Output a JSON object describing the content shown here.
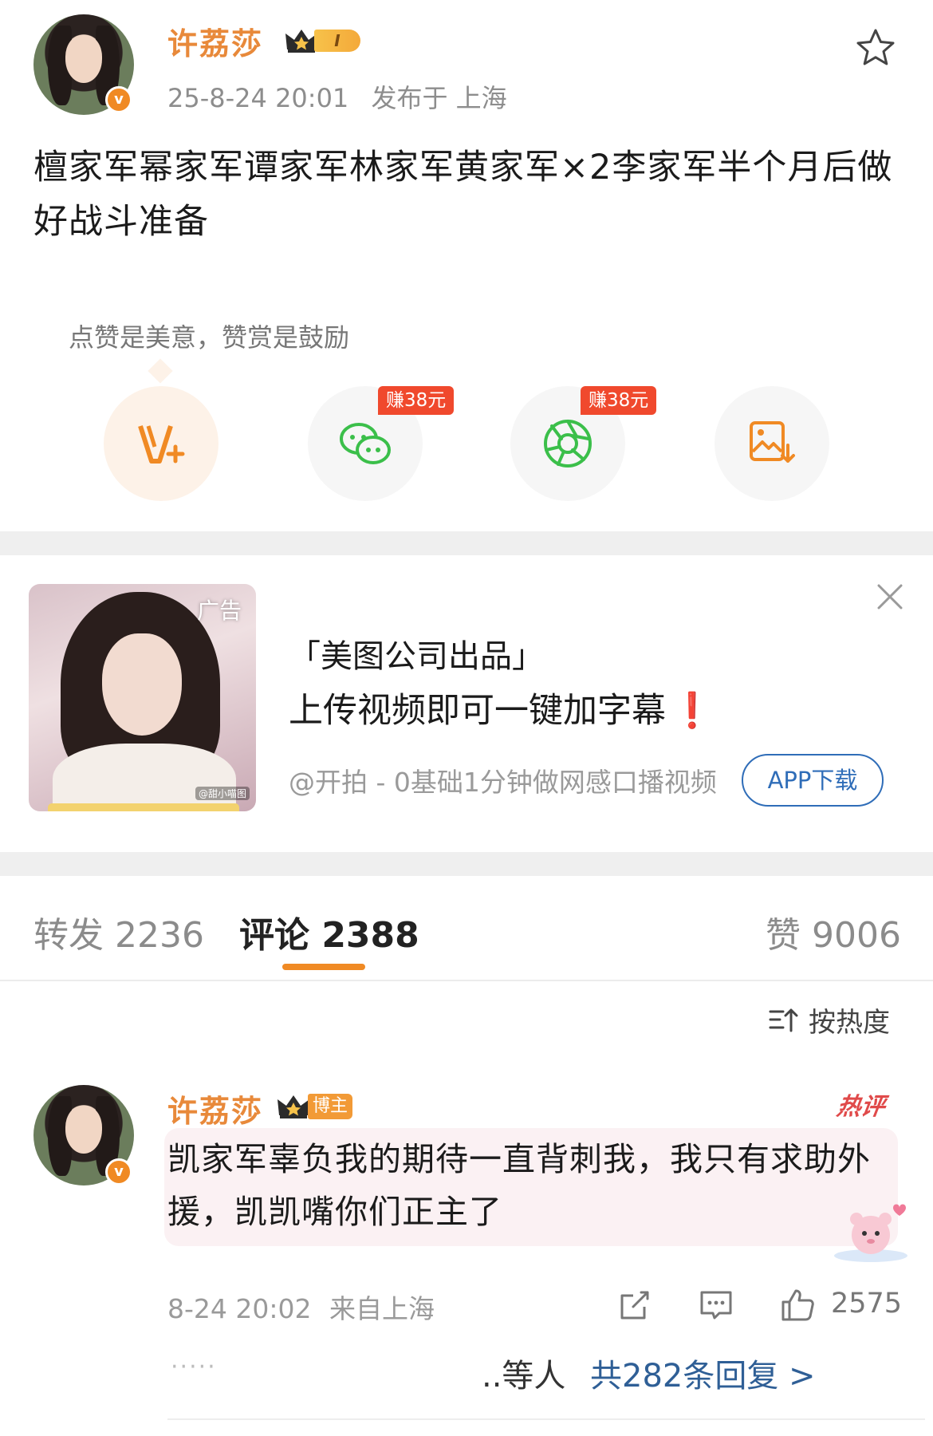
{
  "post": {
    "author": "许荔莎",
    "level": "I",
    "verified_mark": "v",
    "date": "25-8-24 20:01",
    "location": "发布于 上海",
    "content": "檀家军幂家军谭家军林家军黄家军×2李家军半个月后做好战斗准备"
  },
  "reward": {
    "hint": "点赞是美意，赞赏是鼓励",
    "buttons": [
      {
        "icon": "v-plus-icon"
      },
      {
        "icon": "wechat-icon",
        "tag": "赚38元"
      },
      {
        "icon": "moments-shutter-icon",
        "tag": "赚38元"
      },
      {
        "icon": "save-image-icon"
      }
    ]
  },
  "ad": {
    "tag": "广告",
    "watermark": "@甜小喵图",
    "line1": "「美图公司出品」",
    "line2": "上传视频即可一键加字幕",
    "line2_mark": "❗",
    "source": "@开拍 - 0基础1分钟做网感口播视频",
    "button": "APP下载"
  },
  "tabs": {
    "repost": "转发 2236",
    "comments": "评论 2388",
    "likes": "赞 9006"
  },
  "sort": {
    "label": "按热度"
  },
  "comment": {
    "author": "许荔莎",
    "role_tag": "博主",
    "hot_label": "热评",
    "verified_mark": "v",
    "text": "凯家军辜负我的期待一直背刺我，我只有求助外援，凯凯嘴你们正主了",
    "time": "8-24 20:02",
    "location": "来自上海",
    "likes": "2575",
    "reply_dots": "·····",
    "reply_summary": "..等人",
    "reply_link": "共282条回复 >"
  },
  "colors": {
    "accent": "#f08a24",
    "username": "#e8893a",
    "link": "#2f5f96",
    "earn_tag": "#f0492d",
    "hot": "#e04a4a"
  }
}
